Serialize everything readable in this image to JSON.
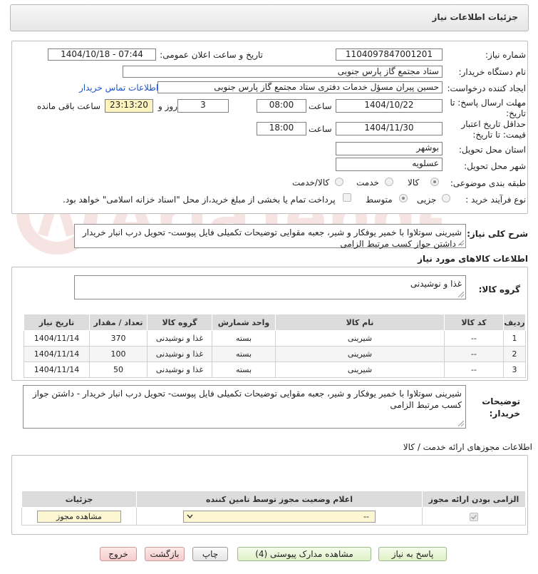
{
  "header": {
    "title": "جزئیات اطلاعات نیاز"
  },
  "form": {
    "need_number_label": "شماره نیاز:",
    "need_number": "1104097847001201",
    "announce_label": "تاریخ و ساعت اعلان عمومی:",
    "announce_value": "1404/10/18 - 07:44",
    "buyer_org_label": "نام دستگاه خریدار:",
    "buyer_org": "ستاد مجتمع گاز پارس جنوبی",
    "creator_label": "ایجاد کننده درخواست:",
    "creator": "حسین پیران مسؤل خدمات دفتری ستاد مجتمع گاز پارس جنوبی",
    "contact_link": "اطلاعات تماس خریدار",
    "deadline_label_1": "مهلت ارسال پاسخ: تا",
    "deadline_label_2": "تاریخ:",
    "deadline_date": "1404/10/22",
    "time_label": "ساعت",
    "deadline_time": "08:00",
    "days_value": "3",
    "days_label": "روز و",
    "remaining_time": "23:13:20",
    "remaining_label": "ساعت باقی مانده",
    "validity_label_1": "حداقل تاریخ اعتبار",
    "validity_label_2": "قیمت: تا تاریخ:",
    "validity_date": "1404/11/30",
    "validity_time": "18:00",
    "province_label": "استان محل تحویل:",
    "province": "بوشهر",
    "city_label": "شهر محل تحویل:",
    "city": "عسلویه",
    "category_label": "طبقه بندی موضوعی:",
    "category_options": [
      "کالا",
      "خدمت",
      "کالا/خدمت"
    ],
    "process_label": "نوع فرآیند خرید :",
    "process_options": [
      "جزیی",
      "متوسط"
    ],
    "payment_note": "پرداخت تمام یا بخشی از مبلغ خرید،از محل \"اسناد خزانه اسلامی\" خواهد بود."
  },
  "summary": {
    "label": "شرح کلی نیاز:",
    "text": "شیرینی سوتلاوا با خمیر یوفکار و شیر، جعبه مقوایی توضیحات تکمیلی فایل پیوست- تحویل درب انبار خریدار - داشتن جواز کسب مرتبط الزامی"
  },
  "goods": {
    "title": "اطلاعات کالاهای مورد نیاز",
    "group_label": "گروه کالا:",
    "group_value": "غذا و نوشیدنی",
    "columns": [
      "ردیف",
      "کد کالا",
      "نام کالا",
      "واحد شمارش",
      "گروه کالا",
      "تعداد / مقدار",
      "تاریخ نیاز"
    ],
    "rows": [
      [
        "1",
        "--",
        "شیرینی",
        "بسته",
        "غذا و نوشیدنی",
        "370",
        "1404/11/14"
      ],
      [
        "2",
        "--",
        "شیرینی",
        "بسته",
        "غذا و نوشیدنی",
        "100",
        "1404/11/14"
      ],
      [
        "3",
        "--",
        "شیرینی",
        "بسته",
        "غذا و نوشیدنی",
        "50",
        "1404/11/14"
      ]
    ]
  },
  "buyer_notes": {
    "label_1": "توضیحات",
    "label_2": "خریدار:",
    "text": "شیرینی سوتلاوا با خمیر یوفکار و شیر، جعبه مقوایی توضیحات تکمیلی فایل پیوست- تحویل درب انبار خریدار - داشتن جواز کسب مرتبط الزامی"
  },
  "permits": {
    "title": "اطلاعات مجوزهای ارائه خدمت / کالا",
    "columns": [
      "الزامی بودن ارائه مجوز",
      "اعلام وضعیت مجوز توسط تامین کننده",
      "جزئیات"
    ],
    "select_value": "--",
    "view_button": "مشاهده مجوز"
  },
  "buttons": {
    "reply": "پاسخ به نیاز",
    "docs": "مشاهده مدارک پیوستی (4)",
    "print": "چاپ",
    "back": "بازگشت",
    "exit": "خروج"
  },
  "colors": {
    "yellow_field": "#fdf3bf",
    "link": "#1a55c8",
    "table_header": "#dcdcdc"
  }
}
